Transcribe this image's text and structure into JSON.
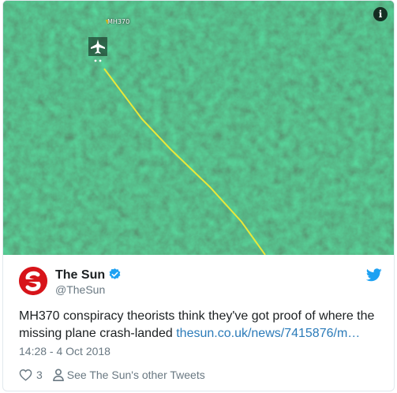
{
  "media": {
    "label": "MH370",
    "info_glyph": "i",
    "colors": {
      "forest_dark": "#1d4a33",
      "forest_light": "#3f7454",
      "trail": "#e6e63a"
    }
  },
  "author": {
    "name": "The Sun",
    "handle": "@TheSun",
    "verified": true,
    "avatar_icon": "the-sun-logo-icon",
    "brand_color": "#d7141a"
  },
  "tweet": {
    "text": "MH370 conspiracy theorists think they've got proof of where the missing plane crash-landed",
    "link": "thesun.co.uk/news/7415876/m…",
    "timestamp": "14:28 - 4 Oct 2018"
  },
  "actions": {
    "like_count": "3",
    "other_tweets_label": "See The Sun's other Tweets"
  },
  "colors": {
    "link": "#2b7bb9",
    "twitter_blue": "#1da1f2",
    "secondary_text": "#697882"
  }
}
